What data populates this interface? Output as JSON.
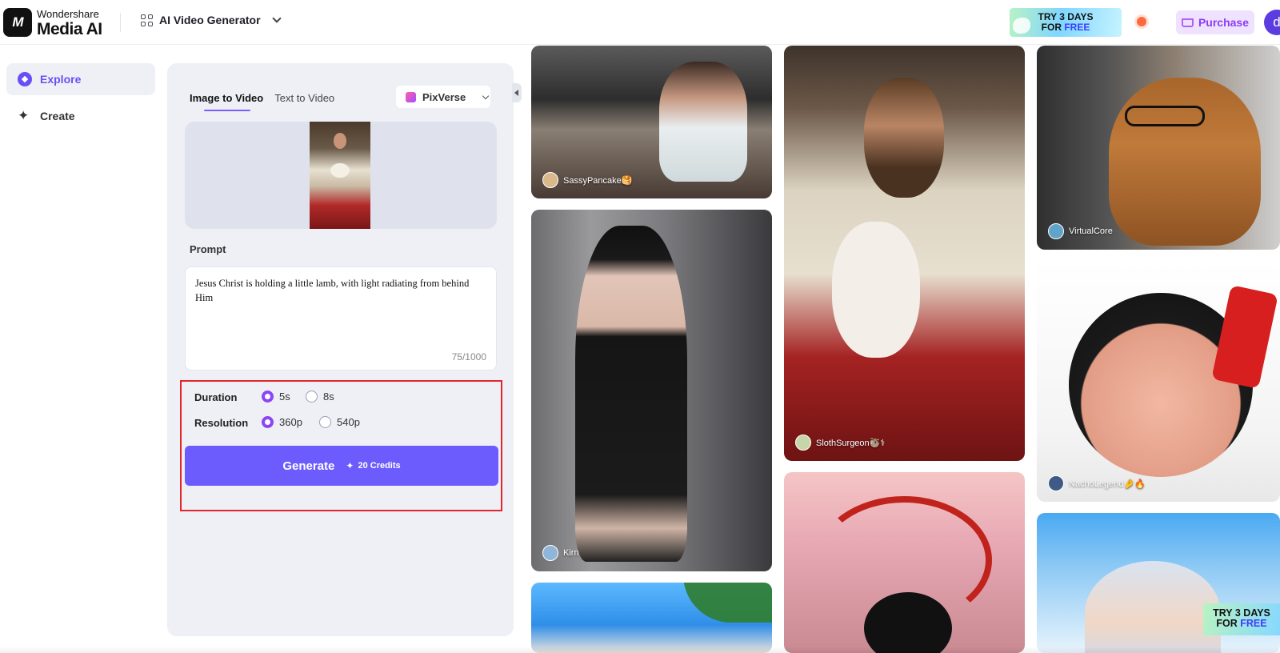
{
  "header": {
    "brand_line1": "Wondershare",
    "brand_line2": "Media AI",
    "logo_mark": "M",
    "product_name": "AI Video Generator",
    "promo_line1": "TRY 3 DAYS",
    "promo_line2_a": "FOR ",
    "promo_line2_b": "FREE",
    "purchase_label": "Purchase",
    "avatar_letter": "d"
  },
  "nav": {
    "items": [
      {
        "label": "Explore",
        "icon": "compass-icon",
        "active": true
      },
      {
        "label": "Create",
        "icon": "sparkle-icon",
        "active": false
      }
    ]
  },
  "panel": {
    "tabs": [
      {
        "label": "Image to Video",
        "active": true
      },
      {
        "label": "Text to Video",
        "active": false
      }
    ],
    "model": "PixVerse",
    "prompt_label": "Prompt",
    "prompt_text": "Jesus Christ is holding a little lamb, with light radiating from behind Him",
    "char_count": "75/1000",
    "duration": {
      "label": "Duration",
      "options": [
        "5s",
        "8s"
      ],
      "selected": "5s"
    },
    "resolution": {
      "label": "Resolution",
      "options": [
        "360p",
        "540p"
      ],
      "selected": "360p"
    },
    "generate_label": "Generate",
    "credits_label": "20 Credits"
  },
  "gallery": [
    {
      "user": "SassyPancake🥞"
    },
    {
      "user": "Kirn"
    },
    {
      "user": ""
    },
    {
      "user": "SlothSurgeon🦥⚕"
    },
    {
      "user": ""
    },
    {
      "user": "VirtualCore"
    },
    {
      "user": "NachoLegend🤌🔥"
    },
    {
      "user": ""
    }
  ],
  "floating_promo": {
    "line1": "TRY 3 DAYS",
    "line2_a": "FOR ",
    "line2_b": "FREE"
  },
  "colors": {
    "accent": "#6c5bfd",
    "selected_radio": "#8c45f5",
    "highlight_box": "#e3262b",
    "purchase_bg": "#efe2ff"
  }
}
